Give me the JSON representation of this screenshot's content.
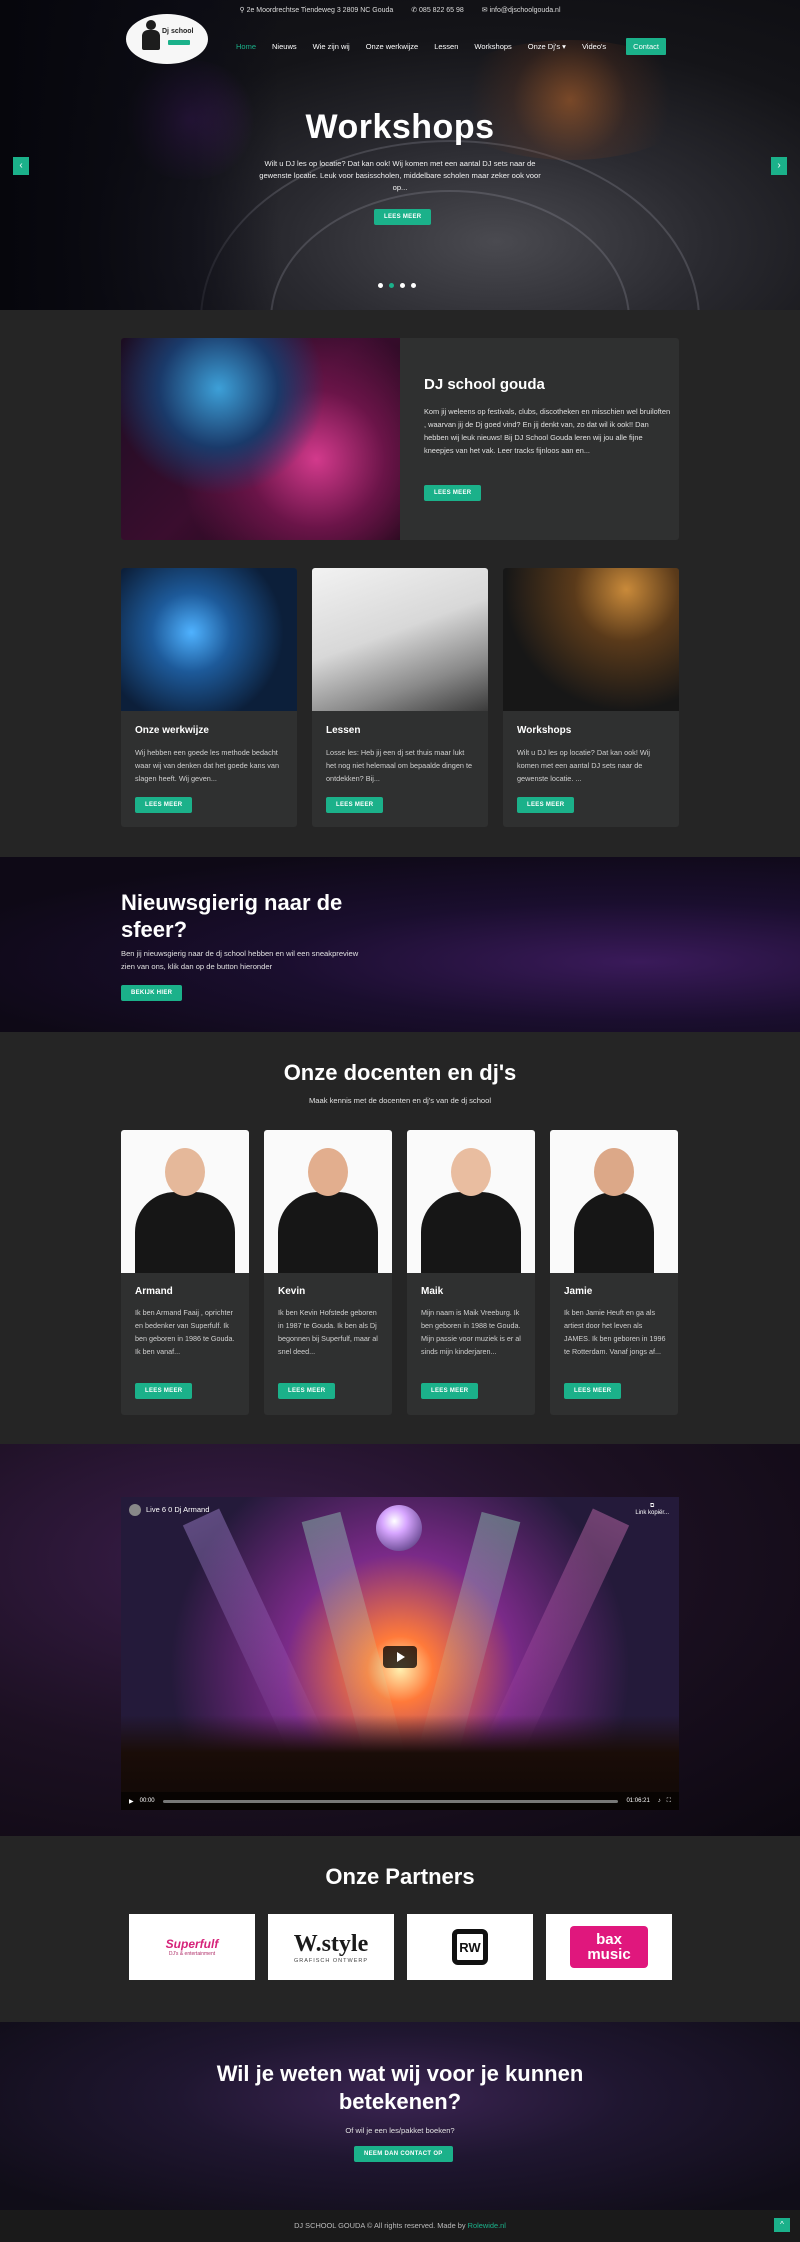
{
  "topbar": {
    "address": "2e Moordrechtse Tiendeweg 3 2809 NC Gouda",
    "phone": "085 822 65 98",
    "email": "info@djschoolgouda.nl"
  },
  "logo": {
    "text": "Dj school"
  },
  "nav": {
    "items": [
      "Home",
      "Nieuws",
      "Wie zijn wij",
      "Onze werkwijze",
      "Lessen",
      "Workshops",
      "Onze Dj's",
      "Video's"
    ],
    "contact": "Contact"
  },
  "hero": {
    "title": "Workshops",
    "text": "Wilt u DJ les op locatie? Dat kan ook! Wij komen met een aantal DJ sets naar de gewenste locatie.  Leuk voor basisscholen, middelbare scholen maar zeker ook voor op...",
    "button": "LEES MEER",
    "prev": "‹",
    "next": "›"
  },
  "featured": {
    "title": "DJ school gouda",
    "text": "Kom jij weleens op festivals, clubs, discotheken en misschien wel bruiloften , waarvan jij de Dj goed vind? En jij denkt van, zo dat wil ik ook!! Dan hebben wij leuk nieuws! Bij DJ School Gouda leren wij jou alle fijne kneepjes van het vak. Leer tracks fijnloos aan en...",
    "button": "LEES MEER"
  },
  "cards": [
    {
      "title": "Onze werkwijze",
      "text": "Wij hebben een goede les methode bedacht waar wij van denken dat het goede kans van slagen heeft. Wij geven...",
      "button": "LEES MEER"
    },
    {
      "title": "Lessen",
      "text": "Losse les: Heb jij een dj set thuis maar lukt het nog niet helemaal om bepaalde dingen te ontdekken? Bij...",
      "button": "LEES MEER"
    },
    {
      "title": "Workshops",
      "text": "Wilt u DJ les op locatie? Dat kan ook! Wij komen met een aantal DJ sets naar de gewenste locatie.  ...",
      "button": "LEES MEER"
    }
  ],
  "curious": {
    "title": "Nieuwsgierig naar de sfeer?",
    "text": "Ben jij nieuwsgierig naar de dj school hebben en wil een sneakpreview zien van ons, klik dan op de button hieronder",
    "button": "BEKIJK HIER"
  },
  "teachers_section": {
    "title": "Onze docenten en dj's",
    "subtitle": "Maak kennis met de docenten en dj's van de dj school"
  },
  "teachers": [
    {
      "name": "Armand",
      "text": "Ik ben Armand Faaij , oprichter en bedenker van Superfulf.  Ik ben geboren in 1986 te Gouda. Ik ben vanaf...",
      "button": "LEES MEER"
    },
    {
      "name": "Kevin",
      "text": "Ik ben Kevin Hofstede geboren in 1987 te Gouda. Ik ben als Dj begonnen bij Superfulf, maar al snel deed...",
      "button": "LEES MEER"
    },
    {
      "name": "Maik",
      "text": "Mijn naam is Maik Vreeburg. Ik ben geboren in 1988 te Gouda.  Mijn passie voor muziek is er al sinds mijn kinderjaren...",
      "button": "LEES MEER"
    },
    {
      "name": "Jamie",
      "text": "Ik ben Jamie Heuft en ga als artiest door het leven als JAMES. Ik ben geboren in 1996 te Rotterdam. Vanaf jongs af...",
      "button": "LEES MEER"
    }
  ],
  "video": {
    "title": "Live 6 0 Dj Armand",
    "copy_link": "Link kopiër...",
    "time_current": "00:00",
    "time_total": "01:06:21"
  },
  "partners": {
    "title": "Onze Partners",
    "items": [
      "Superfulf",
      "W.style",
      "RW",
      "bax music"
    ],
    "subs": [
      "DJ's & entertainment",
      "GRAFISCH ONTWERP"
    ]
  },
  "cta": {
    "title": "Wil je weten wat wij voor je kunnen betekenen?",
    "text": "Of wil je een les/pakket boeken?",
    "button": "NEEM DAN CONTACT OP"
  },
  "footer": {
    "text": "DJ SCHOOL GOUDA © All rights reserved. Made by",
    "link": "Rolewide.nl",
    "totop": "^"
  },
  "colors": {
    "accent": "#1bb18a",
    "background": "#252525",
    "card": "#2f3030"
  }
}
